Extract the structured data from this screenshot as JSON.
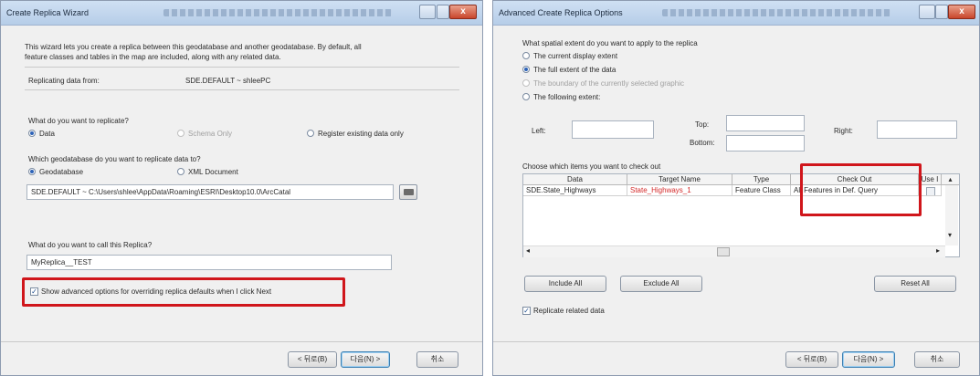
{
  "left_window": {
    "title": "Create Replica Wizard",
    "intro": [
      "This wizard lets you create a replica between this geodatabase  and another geodatabase. By default, all",
      "feature classes and tables in the map are included, along with any related data."
    ],
    "replicating_from_label": "Replicating data from:",
    "replicating_from_value": "SDE.DEFAULT ~ shleePC",
    "replicate_question": "What do you want to replicate?",
    "replicate_options": [
      {
        "label": "Data",
        "selected": true,
        "enabled": true
      },
      {
        "label": "Schema Only",
        "selected": false,
        "enabled": false
      },
      {
        "label": "Register existing data only",
        "selected": false,
        "enabled": true
      }
    ],
    "target_question": "Which geodatabase do you want to replicate data to?",
    "target_options": [
      {
        "label": "Geodatabase",
        "selected": true,
        "enabled": true
      },
      {
        "label": "XML Document",
        "selected": false,
        "enabled": true
      }
    ],
    "target_path": "SDE.DEFAULT ~ C:\\Users\\shlee\\AppData\\Roaming\\ESRI\\Desktop10.0\\ArcCatal",
    "name_question": "What do you want to call this Replica?",
    "replica_name": "MyReplica__TEST",
    "advanced_checkbox_label": "Show advanced options for overriding replica defaults when I click Next",
    "advanced_checked": true,
    "back_button": "< 뒤로(B)",
    "next_button": "다음(N) >",
    "cancel_button": "취소",
    "highlight_color": "#d0161b"
  },
  "right_window": {
    "title": "Advanced Create Replica Options",
    "extent_question": "What spatial extent do you want to apply to the replica",
    "extent_options": [
      {
        "label": "The current display extent",
        "selected": false,
        "enabled": true
      },
      {
        "label": "The full extent of the data",
        "selected": true,
        "enabled": true
      },
      {
        "label": "The boundary of the currently selected graphic",
        "selected": false,
        "enabled": false
      },
      {
        "label": "The following extent:",
        "selected": false,
        "enabled": true
      }
    ],
    "left_label": "Left:",
    "top_label": "Top:",
    "bottom_label": "Bottom:",
    "right_label": "Right:",
    "checkout_question": "Choose which items you want to check out",
    "table_headers": [
      "Data",
      "Target Name",
      "Type",
      "Check Out",
      "Use I"
    ],
    "table_rows": [
      {
        "data": "SDE.State_Highways",
        "target_name": "State_Highways_1",
        "type": "Feature Class",
        "check_out": "All Features in Def. Query"
      }
    ],
    "target_name_color": "#d42a2a",
    "include_all": "Include All",
    "exclude_all": "Exclude All",
    "reset_all": "Reset All",
    "replicate_related_label": "Replicate related data",
    "replicate_related_checked": true,
    "back_button": "< 뒤로(B)",
    "next_button": "다음(N) >",
    "cancel_button": "취소"
  }
}
